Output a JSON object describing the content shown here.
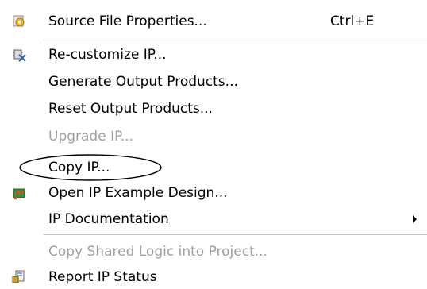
{
  "menu": {
    "items": [
      {
        "label": "Source File Properties...",
        "shortcut": "Ctrl+E",
        "icon": "source-file-properties-icon"
      },
      {
        "label": "Re-customize IP...",
        "icon": "recustomize-ip-icon"
      },
      {
        "label": "Generate Output Products..."
      },
      {
        "label": "Reset Output Products..."
      },
      {
        "label": "Upgrade IP...",
        "disabled": true
      },
      {
        "label": "Copy IP..."
      },
      {
        "label": "Open IP Example Design...",
        "icon": "open-example-design-icon"
      },
      {
        "label": "IP Documentation",
        "submenu": true
      },
      {
        "label": "Copy Shared Logic into Project...",
        "disabled": true
      },
      {
        "label": "Report IP Status",
        "icon": "report-ip-status-icon"
      }
    ]
  },
  "colors": {
    "disabled_text": "#a0a0a0",
    "separator": "#c4c4c4",
    "annotation_ellipse": "#000000"
  }
}
